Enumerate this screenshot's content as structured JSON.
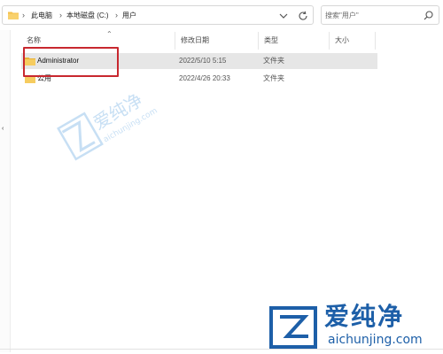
{
  "address_bar": {
    "crumbs": [
      "此电脑",
      "本地磁盘 (C:)",
      "用户"
    ]
  },
  "search": {
    "placeholder": "搜索\"用户\""
  },
  "columns": {
    "name": "名称",
    "date": "修改日期",
    "type": "类型",
    "size": "大小"
  },
  "rows": [
    {
      "name": "Administrator",
      "date": "2022/5/10 5:15",
      "type": "文件夹",
      "selected": true
    },
    {
      "name": "公用",
      "date": "2022/4/26 20:33",
      "type": "文件夹",
      "selected": false
    }
  ],
  "watermark": {
    "cn": "爱纯净",
    "en": "aichunjing.com"
  },
  "logo": {
    "cn": "爱纯净",
    "en": "aichunjing.com"
  },
  "colors": {
    "accent": "#1d5fa8",
    "highlight": "#c8282f",
    "folder": "#f4c04b",
    "selected_row": "#e6e6e6"
  }
}
